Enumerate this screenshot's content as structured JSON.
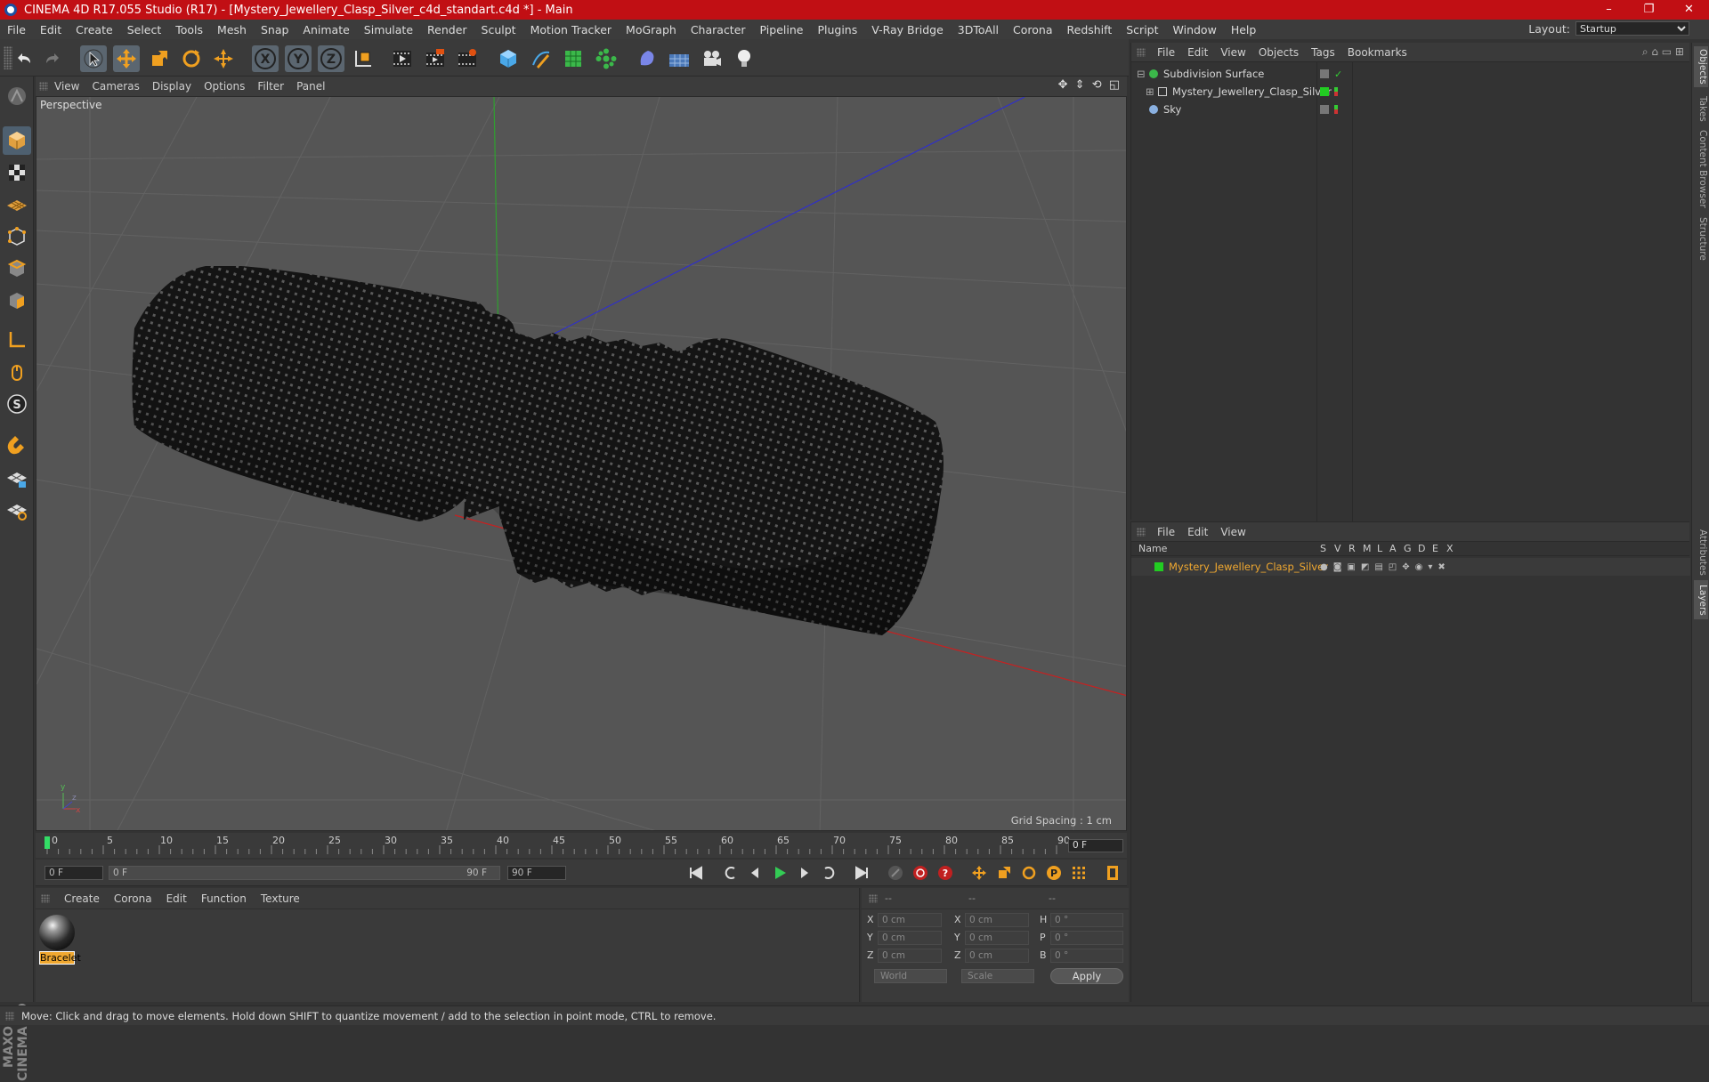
{
  "window": {
    "title": "CINEMA 4D R17.055 Studio (R17) - [Mystery_Jewellery_Clasp_Silver_c4d_standart.c4d *] - Main",
    "controls": [
      "–",
      "❐",
      "✕"
    ]
  },
  "menubar": {
    "items": [
      "File",
      "Edit",
      "Create",
      "Select",
      "Tools",
      "Mesh",
      "Snap",
      "Animate",
      "Simulate",
      "Render",
      "Sculpt",
      "Motion Tracker",
      "MoGraph",
      "Character",
      "Pipeline",
      "Plugins",
      "V-Ray Bridge",
      "3DToAll",
      "Corona",
      "Redshift",
      "Script",
      "Window",
      "Help"
    ],
    "layout_label": "Layout:",
    "layout_value": "Startup"
  },
  "toolbar": {
    "icons": [
      "undo-icon",
      "redo-icon",
      "select-arrow-icon",
      "move-icon",
      "scale-icon",
      "rotate-icon",
      "live-select-icon",
      "x-axis-icon",
      "y-axis-icon",
      "z-axis-icon",
      "coordinate-system-icon",
      "render-view-icon",
      "render-picture-viewer-icon",
      "render-settings-icon",
      "cube-icon",
      "pen-icon",
      "subdivision-icon",
      "array-icon",
      "deformer-icon",
      "floor-icon",
      "camera-icon",
      "light-icon"
    ],
    "axis_labels": [
      "X",
      "Y",
      "Z"
    ]
  },
  "lefttools": [
    "make-editable-icon",
    "model-mode-icon",
    "texture-mode-icon",
    "workplane-mode-icon",
    "points-mode-icon",
    "edges-mode-icon",
    "polygons-mode-icon",
    "axis-mode-icon",
    "tweak-mode-icon",
    "solo-mode-icon",
    "snap-magnet-icon",
    "lock-workplane-icon",
    "planar-workplane-icon"
  ],
  "viewport": {
    "menu": [
      "View",
      "Cameras",
      "Display",
      "Options",
      "Filter",
      "Panel"
    ],
    "label": "Perspective",
    "grid_spacing": "Grid Spacing : 1 cm",
    "nav_icons": "✥ ⇕ ⟲ ◱"
  },
  "timeline": {
    "ticks": [
      "0",
      "5",
      "10",
      "15",
      "20",
      "25",
      "30",
      "35",
      "40",
      "45",
      "50",
      "55",
      "60",
      "65",
      "70",
      "75",
      "80",
      "85",
      "90"
    ],
    "current_frame": "0 F",
    "start_field": "0 F",
    "range_start": "0 F",
    "range_end": "90 F",
    "end_field": "90 F"
  },
  "materials": {
    "menu": [
      "Create",
      "Corona",
      "Edit",
      "Function",
      "Texture"
    ],
    "items": [
      {
        "name": "Bracelet"
      }
    ]
  },
  "coordinates": {
    "header": [
      "--",
      "--",
      "--"
    ],
    "rows": [
      {
        "a": "X",
        "v1": "0 cm",
        "b": "X",
        "v2": "0 cm",
        "c": "H",
        "v3": "0 °"
      },
      {
        "a": "Y",
        "v1": "0 cm",
        "b": "Y",
        "v2": "0 cm",
        "c": "P",
        "v3": "0 °"
      },
      {
        "a": "Z",
        "v1": "0 cm",
        "b": "Z",
        "v2": "0 cm",
        "c": "B",
        "v3": "0 °"
      }
    ],
    "mode1": "World",
    "mode2": "Scale",
    "apply": "Apply"
  },
  "object_manager": {
    "menu": [
      "File",
      "Edit",
      "View",
      "Objects",
      "Tags",
      "Bookmarks"
    ],
    "objects": [
      {
        "name": "Subdivision Surface",
        "icon": "subdivision-icon"
      },
      {
        "name": "Mystery_Jewellery_Clasp_Silver",
        "icon": "null-object-icon"
      },
      {
        "name": "Sky",
        "icon": "sky-icon"
      }
    ]
  },
  "layer_manager": {
    "menu": [
      "File",
      "Edit",
      "View"
    ],
    "columns": [
      "Name",
      "S",
      "V",
      "R",
      "M",
      "L",
      "A",
      "G",
      "D",
      "E",
      "X"
    ],
    "layers": [
      {
        "name": "Mystery_Jewellery_Clasp_Silver"
      }
    ]
  },
  "right_tabs": [
    "Objects",
    "Takes",
    "Content Browser",
    "Structure",
    "Attributes",
    "Layers"
  ],
  "status": "Move: Click and drag to move elements. Hold down SHIFT to quantize movement / add to the selection in point mode, CTRL to remove.",
  "branding": "MAXON CINEMA 4D",
  "colors": {
    "title_bar": "#c10f14",
    "accent": "#f0a830",
    "layer_green": "#22cc22"
  }
}
